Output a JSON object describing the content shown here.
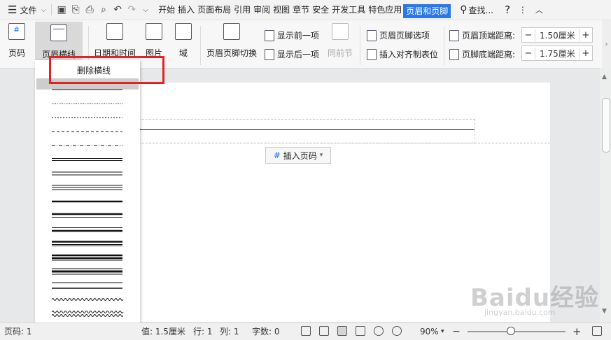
{
  "menubar": {
    "file_label": "文件",
    "tabs": [
      "开始",
      "插入",
      "页面布局",
      "引用",
      "审阅",
      "视图",
      "章节",
      "安全",
      "开发工具",
      "特色应用",
      "页眉和页脚"
    ],
    "active_tab": "页眉和页脚",
    "search_label": "查找...",
    "help": "?"
  },
  "ribbon": {
    "page_number": "页码",
    "header_rule": "页眉横线",
    "date_time": "日期和时间",
    "picture": "图片",
    "field": "域",
    "switch_header_footer": "页眉页脚切换",
    "show_previous": "显示前一项",
    "show_next": "显示后一项",
    "same_as_previous": "同前节",
    "header_footer_options": "页眉页脚选项",
    "insert_align_tab": "插入对齐制表位",
    "header_top_label": "页眉顶端距离:",
    "header_top_value": "1.50厘米",
    "footer_bottom_label": "页脚底端距离:",
    "footer_bottom_value": "1.75厘米"
  },
  "dropdown": {
    "delete_rule": "删除横线",
    "line_styles": [
      "solid-thin",
      "dotted",
      "dashed-fine",
      "dashed",
      "dash-dot",
      "double-thin",
      "double",
      "triple",
      "thick",
      "thick-thin",
      "thin-thick",
      "thick-double",
      "thick-triple",
      "thin-thick-thin",
      "double-spaced",
      "wave",
      "double-wave"
    ]
  },
  "document": {
    "insert_page_number": "插入页码"
  },
  "status": {
    "page": "页码: 1",
    "setting_value": "值: 1.5厘米",
    "row": "行: 1",
    "col": "列: 1",
    "chars": "字数: 0",
    "zoom": "90%"
  },
  "watermark": {
    "brand": "Baidu经验",
    "url": "jingyan.baidu.com"
  },
  "colors": {
    "accent": "#2b78e4",
    "highlight": "#e52222"
  }
}
